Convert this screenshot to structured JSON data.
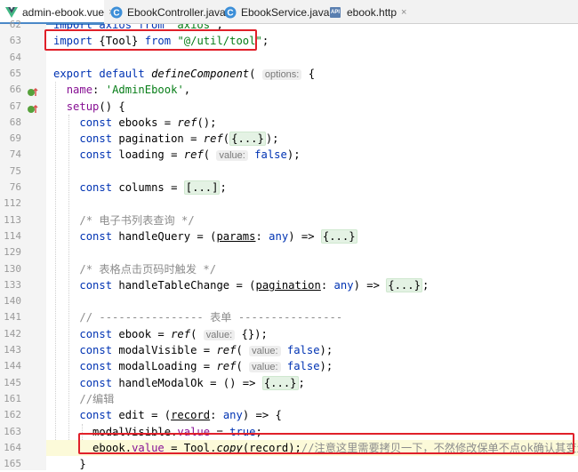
{
  "tabs": [
    {
      "label": "admin-ebook.vue",
      "close": "×",
      "icon": "vue-icon",
      "active": true
    },
    {
      "label": "EbookController.java",
      "close": "×",
      "icon": "class-icon",
      "active": false
    },
    {
      "label": "EbookService.java",
      "close": "×",
      "icon": "class-icon",
      "active": false
    },
    {
      "label": "ebook.http",
      "close": "×",
      "icon": "api-icon",
      "icon_text": "API",
      "active": false
    }
  ],
  "colors": {
    "keyword": "#0033b3",
    "string": "#067d17",
    "property": "#871094",
    "comment": "#8c8c8c",
    "highlight_box": "#e0202a",
    "fold_bg": "#e4f2e4"
  },
  "gutter_icons": [
    "override-icon",
    "override-icon"
  ],
  "lines": [
    {
      "num": "62",
      "parts": [
        {
          "t": "import axios from ",
          "c": "kw"
        },
        {
          "t": "'axios'",
          "c": "str"
        },
        {
          "t": ";"
        }
      ]
    },
    {
      "num": "63",
      "parts": [
        {
          "t": "import",
          "c": "kw"
        },
        {
          "t": " {Tool} "
        },
        {
          "t": "from",
          "c": "kw"
        },
        {
          "t": " "
        },
        {
          "t": "\"@/util/tool\"",
          "c": "str"
        },
        {
          "t": ";"
        }
      ]
    },
    {
      "num": "64",
      "parts": []
    },
    {
      "num": "65",
      "parts": [
        {
          "t": "export default",
          "c": "kw"
        },
        {
          "t": " "
        },
        {
          "t": "defineComponent",
          "c": "it"
        },
        {
          "t": "( "
        },
        {
          "t": "options:",
          "c": "hint"
        },
        {
          "t": " {"
        }
      ]
    },
    {
      "num": "66",
      "parts": [
        {
          "t": "  "
        },
        {
          "t": "name",
          "c": "prop"
        },
        {
          "t": ": "
        },
        {
          "t": "'AdminEbook'",
          "c": "str"
        },
        {
          "t": ","
        }
      ]
    },
    {
      "num": "67",
      "parts": [
        {
          "t": "  "
        },
        {
          "t": "setup",
          "c": "prop"
        },
        {
          "t": "() {"
        }
      ]
    },
    {
      "num": "68",
      "parts": [
        {
          "t": "    "
        },
        {
          "t": "const",
          "c": "kw"
        },
        {
          "t": " ebooks = "
        },
        {
          "t": "ref",
          "c": "it"
        },
        {
          "t": "();"
        }
      ]
    },
    {
      "num": "69",
      "parts": [
        {
          "t": "    "
        },
        {
          "t": "const",
          "c": "kw"
        },
        {
          "t": " pagination = "
        },
        {
          "t": "ref",
          "c": "it"
        },
        {
          "t": "("
        },
        {
          "t": "{...}",
          "c": "fold"
        },
        {
          "t": ");"
        }
      ]
    },
    {
      "num": "74",
      "parts": [
        {
          "t": "    "
        },
        {
          "t": "const",
          "c": "kw"
        },
        {
          "t": " loading = "
        },
        {
          "t": "ref",
          "c": "it"
        },
        {
          "t": "( "
        },
        {
          "t": "value:",
          "c": "hint"
        },
        {
          "t": " "
        },
        {
          "t": "false",
          "c": "kw"
        },
        {
          "t": ");"
        }
      ]
    },
    {
      "num": "75",
      "parts": []
    },
    {
      "num": "76",
      "parts": [
        {
          "t": "    "
        },
        {
          "t": "const",
          "c": "kw"
        },
        {
          "t": " columns = "
        },
        {
          "t": "[...]",
          "c": "fold"
        },
        {
          "t": ";"
        }
      ]
    },
    {
      "num": "112",
      "parts": []
    },
    {
      "num": "113",
      "parts": [
        {
          "t": "    "
        },
        {
          "t": "/* 电子书列表查询 */",
          "c": "cmt"
        }
      ]
    },
    {
      "num": "114",
      "parts": [
        {
          "t": "    "
        },
        {
          "t": "const",
          "c": "kw"
        },
        {
          "t": " handleQuery = ("
        },
        {
          "t": "params",
          "c": "ul"
        },
        {
          "t": ": "
        },
        {
          "t": "any",
          "c": "kw"
        },
        {
          "t": ") => "
        },
        {
          "t": "{...}",
          "c": "fold"
        }
      ]
    },
    {
      "num": "129",
      "parts": []
    },
    {
      "num": "130",
      "parts": [
        {
          "t": "    "
        },
        {
          "t": "/* 表格点击页码时触发 */",
          "c": "cmt"
        }
      ]
    },
    {
      "num": "133",
      "parts": [
        {
          "t": "    "
        },
        {
          "t": "const",
          "c": "kw"
        },
        {
          "t": " handleTableChange = ("
        },
        {
          "t": "pagination",
          "c": "ul"
        },
        {
          "t": ": "
        },
        {
          "t": "any",
          "c": "kw"
        },
        {
          "t": ") => "
        },
        {
          "t": "{...}",
          "c": "fold"
        },
        {
          "t": ";"
        }
      ]
    },
    {
      "num": "140",
      "parts": []
    },
    {
      "num": "141",
      "parts": [
        {
          "t": "    "
        },
        {
          "t": "// ---------------- 表单 ----------------",
          "c": "cmt"
        }
      ]
    },
    {
      "num": "142",
      "parts": [
        {
          "t": "    "
        },
        {
          "t": "const",
          "c": "kw"
        },
        {
          "t": " ebook = "
        },
        {
          "t": "ref",
          "c": "it"
        },
        {
          "t": "( "
        },
        {
          "t": "value:",
          "c": "hint"
        },
        {
          "t": " {});"
        }
      ]
    },
    {
      "num": "143",
      "parts": [
        {
          "t": "    "
        },
        {
          "t": "const",
          "c": "kw"
        },
        {
          "t": " modalVisible = "
        },
        {
          "t": "ref",
          "c": "it"
        },
        {
          "t": "( "
        },
        {
          "t": "value:",
          "c": "hint"
        },
        {
          "t": " "
        },
        {
          "t": "false",
          "c": "kw"
        },
        {
          "t": ");"
        }
      ]
    },
    {
      "num": "144",
      "parts": [
        {
          "t": "    "
        },
        {
          "t": "const",
          "c": "kw"
        },
        {
          "t": " modalLoading = "
        },
        {
          "t": "ref",
          "c": "it"
        },
        {
          "t": "( "
        },
        {
          "t": "value:",
          "c": "hint"
        },
        {
          "t": " "
        },
        {
          "t": "false",
          "c": "kw"
        },
        {
          "t": ");"
        }
      ]
    },
    {
      "num": "145",
      "parts": [
        {
          "t": "    "
        },
        {
          "t": "const",
          "c": "kw"
        },
        {
          "t": " handleModalOk = () => "
        },
        {
          "t": "{...}",
          "c": "fold"
        },
        {
          "t": ";"
        }
      ]
    },
    {
      "num": "161",
      "parts": [
        {
          "t": "    "
        },
        {
          "t": "//编辑",
          "c": "cmt"
        }
      ]
    },
    {
      "num": "162",
      "parts": [
        {
          "t": "    "
        },
        {
          "t": "const",
          "c": "kw"
        },
        {
          "t": " edit = ("
        },
        {
          "t": "record",
          "c": "ul"
        },
        {
          "t": ": "
        },
        {
          "t": "any",
          "c": "kw"
        },
        {
          "t": ") => {"
        }
      ]
    },
    {
      "num": "163",
      "parts": [
        {
          "t": "      modalVisible."
        },
        {
          "t": "value",
          "c": "prop"
        },
        {
          "t": " = "
        },
        {
          "t": "true",
          "c": "kw"
        },
        {
          "t": ";"
        }
      ]
    },
    {
      "num": "164",
      "parts": [
        {
          "t": "      ebook."
        },
        {
          "t": "value",
          "c": "prop"
        },
        {
          "t": " = Tool."
        },
        {
          "t": "copy",
          "c": "it"
        },
        {
          "t": "("
        },
        {
          "t": "record",
          "c": "ul"
        },
        {
          "t": ");"
        },
        {
          "t": "//注意这里需要拷贝一下，不然修改保单不点ok确认其变量的值也会变",
          "c": "cmt"
        }
      ]
    },
    {
      "num": "165",
      "parts": [
        {
          "t": "    }"
        }
      ]
    }
  ]
}
